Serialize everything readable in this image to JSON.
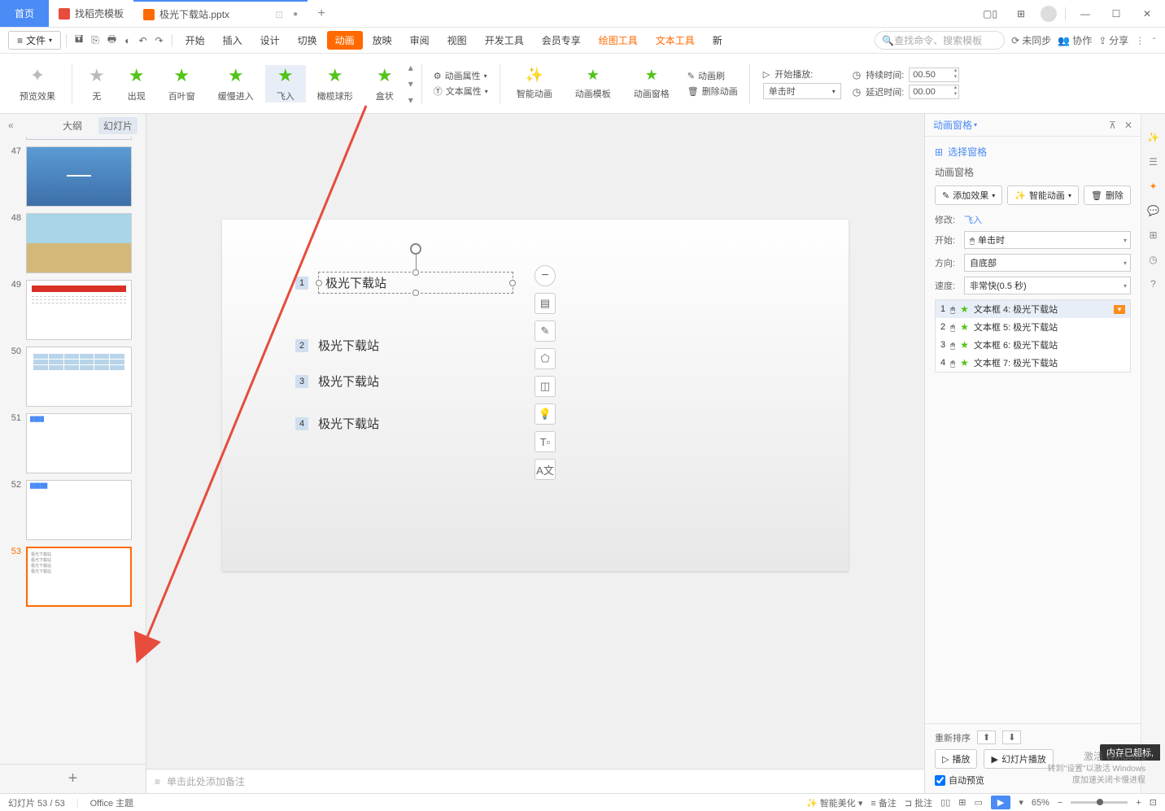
{
  "titlebar": {
    "home": "首页",
    "tab1": "找稻壳模板",
    "tab2": "极光下载站.pptx",
    "add": "+"
  },
  "menubar": {
    "file": "文件",
    "items": [
      "开始",
      "插入",
      "设计",
      "切换",
      "动画",
      "放映",
      "审阅",
      "视图",
      "开发工具",
      "会员专享",
      "绘图工具",
      "文本工具",
      "新"
    ],
    "active_index": 4,
    "search_placeholder": "查找命令、搜索模板",
    "unsync": "未同步",
    "coop": "协作",
    "share": "分享"
  },
  "ribbon": {
    "preview": "预览效果",
    "effects": [
      "无",
      "出现",
      "百叶窗",
      "缓慢进入",
      "飞入",
      "橄榄球形",
      "盒状"
    ],
    "selected_index": 4,
    "anim_props": "动画属性",
    "text_props": "文本属性",
    "smart_anim": "智能动画",
    "anim_tmpl": "动画模板",
    "anim_pane": "动画窗格",
    "anim_brush": "动画刷",
    "del_anim": "删除动画",
    "start_play": "开始播放:",
    "on_click": "单击时",
    "duration": "持续时间:",
    "duration_val": "00.50",
    "delay": "延迟时间:",
    "delay_val": "00.00"
  },
  "slidepanel": {
    "outline": "大纲",
    "slides": "幻灯片",
    "nums": [
      "47",
      "48",
      "49",
      "50",
      "51",
      "52",
      "53"
    ],
    "add": "+"
  },
  "canvas": {
    "items": [
      "极光下载站",
      "极光下载站",
      "极光下载站",
      "极光下载站"
    ],
    "notes_placeholder": "单击此处添加备注"
  },
  "rightpane": {
    "header": "动画窗格",
    "select_pane": "选择窗格",
    "title": "动画窗格",
    "add_effect": "添加效果",
    "smart_anim": "智能动画",
    "delete": "删除",
    "modify_label": "修改:",
    "modify_val": "飞入",
    "start_label": "开始:",
    "start_val": "单击时",
    "dir_label": "方向:",
    "dir_val": "自底部",
    "speed_label": "速度:",
    "speed_val": "非常快(0.5 秒)",
    "list": [
      {
        "n": "1",
        "t": "文本框 4: 极光下载站"
      },
      {
        "n": "2",
        "t": "文本框 5: 极光下载站"
      },
      {
        "n": "3",
        "t": "文本框 6: 极光下载站"
      },
      {
        "n": "4",
        "t": "文本框 7: 极光下载站"
      }
    ],
    "reorder": "重新排序",
    "play": "播放",
    "slide_play": "幻灯片播放",
    "auto_preview": "自动预览"
  },
  "statusbar": {
    "slide": "幻灯片 53 / 53",
    "theme": "Office 主题",
    "smart_beautify": "智能美化",
    "notes": "备注",
    "comments": "批注",
    "zoom": "65%"
  },
  "watermark": {
    "l1": "激活 Windows",
    "l2": "转到\"设置\"以激活 Windows",
    "l3": "度加速关闭卡慢进程"
  },
  "mem": "内存已超标,"
}
